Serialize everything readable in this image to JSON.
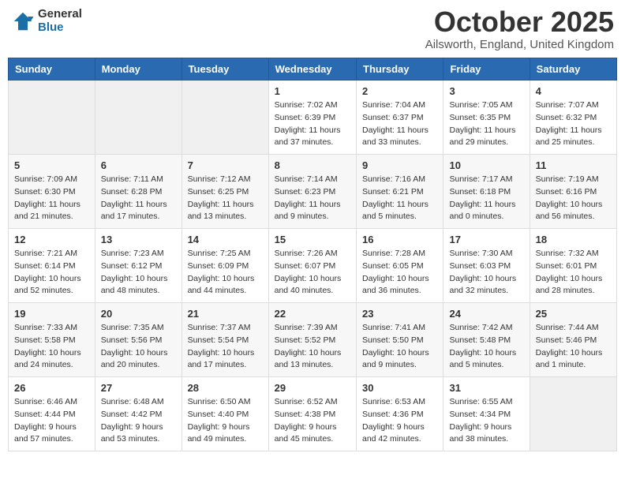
{
  "logo": {
    "general": "General",
    "blue": "Blue"
  },
  "title": "October 2025",
  "location": "Ailsworth, England, United Kingdom",
  "days_header": [
    "Sunday",
    "Monday",
    "Tuesday",
    "Wednesday",
    "Thursday",
    "Friday",
    "Saturday"
  ],
  "weeks": [
    [
      {
        "num": "",
        "info": ""
      },
      {
        "num": "",
        "info": ""
      },
      {
        "num": "",
        "info": ""
      },
      {
        "num": "1",
        "info": "Sunrise: 7:02 AM\nSunset: 6:39 PM\nDaylight: 11 hours and 37 minutes."
      },
      {
        "num": "2",
        "info": "Sunrise: 7:04 AM\nSunset: 6:37 PM\nDaylight: 11 hours and 33 minutes."
      },
      {
        "num": "3",
        "info": "Sunrise: 7:05 AM\nSunset: 6:35 PM\nDaylight: 11 hours and 29 minutes."
      },
      {
        "num": "4",
        "info": "Sunrise: 7:07 AM\nSunset: 6:32 PM\nDaylight: 11 hours and 25 minutes."
      }
    ],
    [
      {
        "num": "5",
        "info": "Sunrise: 7:09 AM\nSunset: 6:30 PM\nDaylight: 11 hours and 21 minutes."
      },
      {
        "num": "6",
        "info": "Sunrise: 7:11 AM\nSunset: 6:28 PM\nDaylight: 11 hours and 17 minutes."
      },
      {
        "num": "7",
        "info": "Sunrise: 7:12 AM\nSunset: 6:25 PM\nDaylight: 11 hours and 13 minutes."
      },
      {
        "num": "8",
        "info": "Sunrise: 7:14 AM\nSunset: 6:23 PM\nDaylight: 11 hours and 9 minutes."
      },
      {
        "num": "9",
        "info": "Sunrise: 7:16 AM\nSunset: 6:21 PM\nDaylight: 11 hours and 5 minutes."
      },
      {
        "num": "10",
        "info": "Sunrise: 7:17 AM\nSunset: 6:18 PM\nDaylight: 11 hours and 0 minutes."
      },
      {
        "num": "11",
        "info": "Sunrise: 7:19 AM\nSunset: 6:16 PM\nDaylight: 10 hours and 56 minutes."
      }
    ],
    [
      {
        "num": "12",
        "info": "Sunrise: 7:21 AM\nSunset: 6:14 PM\nDaylight: 10 hours and 52 minutes."
      },
      {
        "num": "13",
        "info": "Sunrise: 7:23 AM\nSunset: 6:12 PM\nDaylight: 10 hours and 48 minutes."
      },
      {
        "num": "14",
        "info": "Sunrise: 7:25 AM\nSunset: 6:09 PM\nDaylight: 10 hours and 44 minutes."
      },
      {
        "num": "15",
        "info": "Sunrise: 7:26 AM\nSunset: 6:07 PM\nDaylight: 10 hours and 40 minutes."
      },
      {
        "num": "16",
        "info": "Sunrise: 7:28 AM\nSunset: 6:05 PM\nDaylight: 10 hours and 36 minutes."
      },
      {
        "num": "17",
        "info": "Sunrise: 7:30 AM\nSunset: 6:03 PM\nDaylight: 10 hours and 32 minutes."
      },
      {
        "num": "18",
        "info": "Sunrise: 7:32 AM\nSunset: 6:01 PM\nDaylight: 10 hours and 28 minutes."
      }
    ],
    [
      {
        "num": "19",
        "info": "Sunrise: 7:33 AM\nSunset: 5:58 PM\nDaylight: 10 hours and 24 minutes."
      },
      {
        "num": "20",
        "info": "Sunrise: 7:35 AM\nSunset: 5:56 PM\nDaylight: 10 hours and 20 minutes."
      },
      {
        "num": "21",
        "info": "Sunrise: 7:37 AM\nSunset: 5:54 PM\nDaylight: 10 hours and 17 minutes."
      },
      {
        "num": "22",
        "info": "Sunrise: 7:39 AM\nSunset: 5:52 PM\nDaylight: 10 hours and 13 minutes."
      },
      {
        "num": "23",
        "info": "Sunrise: 7:41 AM\nSunset: 5:50 PM\nDaylight: 10 hours and 9 minutes."
      },
      {
        "num": "24",
        "info": "Sunrise: 7:42 AM\nSunset: 5:48 PM\nDaylight: 10 hours and 5 minutes."
      },
      {
        "num": "25",
        "info": "Sunrise: 7:44 AM\nSunset: 5:46 PM\nDaylight: 10 hours and 1 minute."
      }
    ],
    [
      {
        "num": "26",
        "info": "Sunrise: 6:46 AM\nSunset: 4:44 PM\nDaylight: 9 hours and 57 minutes."
      },
      {
        "num": "27",
        "info": "Sunrise: 6:48 AM\nSunset: 4:42 PM\nDaylight: 9 hours and 53 minutes."
      },
      {
        "num": "28",
        "info": "Sunrise: 6:50 AM\nSunset: 4:40 PM\nDaylight: 9 hours and 49 minutes."
      },
      {
        "num": "29",
        "info": "Sunrise: 6:52 AM\nSunset: 4:38 PM\nDaylight: 9 hours and 45 minutes."
      },
      {
        "num": "30",
        "info": "Sunrise: 6:53 AM\nSunset: 4:36 PM\nDaylight: 9 hours and 42 minutes."
      },
      {
        "num": "31",
        "info": "Sunrise: 6:55 AM\nSunset: 4:34 PM\nDaylight: 9 hours and 38 minutes."
      },
      {
        "num": "",
        "info": ""
      }
    ]
  ]
}
